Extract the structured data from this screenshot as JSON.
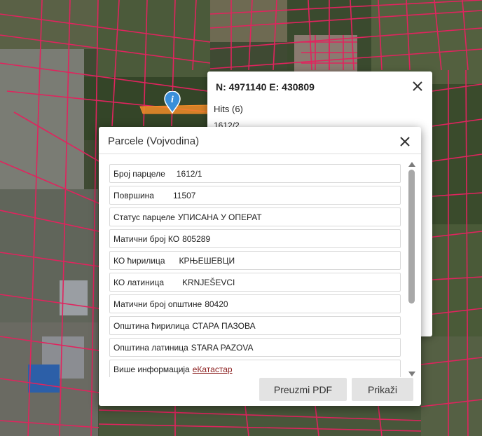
{
  "popup": {
    "coords": "N: 4971140 E: 430809",
    "hits": "Hits (6)",
    "first_hit": "1612/2"
  },
  "dialog": {
    "title": "Parcele (Vojvodina)",
    "rows": [
      {
        "key": "Број парцеле",
        "value": "1612/1"
      },
      {
        "key": "Површина",
        "value": "11507"
      },
      {
        "key": "Статус парцеле",
        "value": "УПИСАНА У ОПЕРАТ"
      },
      {
        "key": "Матични број КО",
        "value": "805289"
      },
      {
        "key": "КО ћирилица",
        "value": "КРЊЕШЕВЦИ"
      },
      {
        "key": "КО латиница",
        "value": "KRNJEŠEVCI"
      },
      {
        "key": "Матични број општине",
        "value": "80420"
      },
      {
        "key": "Општина ћирилица",
        "value": "СТАРА ПАЗОВА"
      },
      {
        "key": "Општина латиница",
        "value": "STARA PAZOVA"
      },
      {
        "key": "Више информација",
        "value": "еКатастар"
      }
    ],
    "buttons": {
      "pdf": "Preuzmi PDF",
      "show": "Prikaži"
    }
  },
  "colors": {
    "parcel_line": "#e0245e",
    "highlight": "#f28c28",
    "marker": "#3a8fd9"
  },
  "icons": {
    "marker": "info-marker-icon",
    "close": "close-icon"
  }
}
